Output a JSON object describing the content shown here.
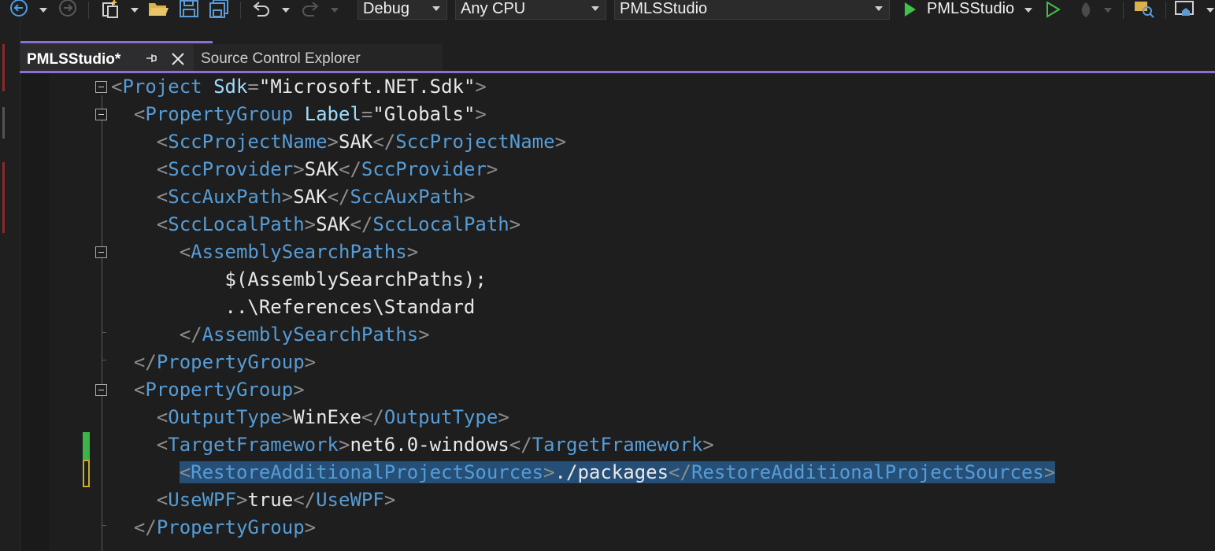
{
  "toolbar": {
    "config": "Debug",
    "platform": "Any CPU",
    "project": "PMLSStudio",
    "start_target": "PMLSStudio",
    "icons": [
      "back-icon",
      "forward-icon",
      "new-project-icon",
      "open-folder-icon",
      "save-icon",
      "save-all-icon",
      "undo-icon",
      "redo-icon",
      "start-icon",
      "start-without-debugging-icon",
      "hot-reload-icon",
      "search-files-icon",
      "layout-icon"
    ]
  },
  "tabs": [
    {
      "label": "PMLSStudio*",
      "active": true
    },
    {
      "label": "Source Control Explorer",
      "active": false
    }
  ],
  "code": [
    [
      [
        "p",
        "<"
      ],
      [
        "t",
        "Project"
      ],
      [
        "v",
        " "
      ],
      [
        "a",
        "Sdk"
      ],
      [
        "p",
        "="
      ],
      [
        "v",
        "\"Microsoft.NET.Sdk\""
      ],
      [
        "p",
        ">"
      ]
    ],
    [
      [
        "v",
        "  "
      ],
      [
        "p",
        "<"
      ],
      [
        "t",
        "PropertyGroup"
      ],
      [
        "v",
        " "
      ],
      [
        "a",
        "Label"
      ],
      [
        "p",
        "="
      ],
      [
        "v",
        "\"Globals\""
      ],
      [
        "p",
        ">"
      ]
    ],
    [
      [
        "v",
        "    "
      ],
      [
        "p",
        "<"
      ],
      [
        "t",
        "SccProjectName"
      ],
      [
        "p",
        ">"
      ],
      [
        "v",
        "SAK"
      ],
      [
        "p",
        "</"
      ],
      [
        "t",
        "SccProjectName"
      ],
      [
        "p",
        ">"
      ]
    ],
    [
      [
        "v",
        "    "
      ],
      [
        "p",
        "<"
      ],
      [
        "t",
        "SccProvider"
      ],
      [
        "p",
        ">"
      ],
      [
        "v",
        "SAK"
      ],
      [
        "p",
        "</"
      ],
      [
        "t",
        "SccProvider"
      ],
      [
        "p",
        ">"
      ]
    ],
    [
      [
        "v",
        "    "
      ],
      [
        "p",
        "<"
      ],
      [
        "t",
        "SccAuxPath"
      ],
      [
        "p",
        ">"
      ],
      [
        "v",
        "SAK"
      ],
      [
        "p",
        "</"
      ],
      [
        "t",
        "SccAuxPath"
      ],
      [
        "p",
        ">"
      ]
    ],
    [
      [
        "v",
        "    "
      ],
      [
        "p",
        "<"
      ],
      [
        "t",
        "SccLocalPath"
      ],
      [
        "p",
        ">"
      ],
      [
        "v",
        "SAK"
      ],
      [
        "p",
        "</"
      ],
      [
        "t",
        "SccLocalPath"
      ],
      [
        "p",
        ">"
      ]
    ],
    [
      [
        "v",
        "      "
      ],
      [
        "p",
        "<"
      ],
      [
        "t",
        "AssemblySearchPaths"
      ],
      [
        "p",
        ">"
      ]
    ],
    [
      [
        "v",
        "          $(AssemblySearchPaths);"
      ]
    ],
    [
      [
        "v",
        "          ..\\References\\Standard"
      ]
    ],
    [
      [
        "v",
        "      "
      ],
      [
        "p",
        "</"
      ],
      [
        "t",
        "AssemblySearchPaths"
      ],
      [
        "p",
        ">"
      ]
    ],
    [
      [
        "v",
        "  "
      ],
      [
        "p",
        "</"
      ],
      [
        "t",
        "PropertyGroup"
      ],
      [
        "p",
        ">"
      ]
    ],
    [
      [
        "v",
        "  "
      ],
      [
        "p",
        "<"
      ],
      [
        "t",
        "PropertyGroup"
      ],
      [
        "p",
        ">"
      ]
    ],
    [
      [
        "v",
        "    "
      ],
      [
        "p",
        "<"
      ],
      [
        "t",
        "OutputType"
      ],
      [
        "p",
        ">"
      ],
      [
        "v",
        "WinExe"
      ],
      [
        "p",
        "</"
      ],
      [
        "t",
        "OutputType"
      ],
      [
        "p",
        ">"
      ]
    ],
    [
      [
        "v",
        "    "
      ],
      [
        "p",
        "<"
      ],
      [
        "t",
        "TargetFramework"
      ],
      [
        "p",
        ">"
      ],
      [
        "v",
        "net6.0-windows"
      ],
      [
        "p",
        "</"
      ],
      [
        "t",
        "TargetFramework"
      ],
      [
        "p",
        ">"
      ]
    ],
    [
      [
        "v",
        "      "
      ],
      [
        "p",
        "<"
      ],
      [
        "t",
        "RestoreAdditionalProjectSources"
      ],
      [
        "p",
        ">"
      ],
      [
        "v",
        "./packages"
      ],
      [
        "p",
        "</"
      ],
      [
        "t",
        "RestoreAdditionalProjectSources"
      ],
      [
        "p",
        ">"
      ]
    ],
    [
      [
        "v",
        "    "
      ],
      [
        "p",
        "<"
      ],
      [
        "t",
        "UseWPF"
      ],
      [
        "p",
        ">"
      ],
      [
        "v",
        "true"
      ],
      [
        "p",
        "</"
      ],
      [
        "t",
        "UseWPF"
      ],
      [
        "p",
        ">"
      ]
    ],
    [
      [
        "v",
        "  "
      ],
      [
        "p",
        "</"
      ],
      [
        "t",
        "PropertyGroup"
      ],
      [
        "p",
        ">"
      ]
    ]
  ],
  "highlighted_line": 14,
  "colors": {
    "accent": "#8b6fd6",
    "tag": "#569cd6",
    "punct": "#8c8c8c",
    "attr": "#9cdcfe",
    "selection": "#264f78"
  }
}
